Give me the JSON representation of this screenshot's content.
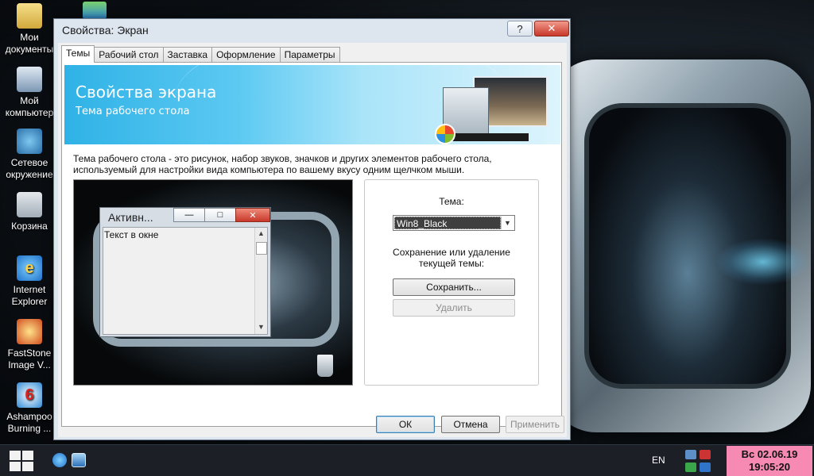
{
  "desktop": {
    "icons": [
      {
        "line1": "Мои",
        "line2": "документы"
      },
      {
        "line1": "Мой",
        "line2": "компьютер"
      },
      {
        "line1": "Сетевое",
        "line2": "окружение"
      },
      {
        "line1": "Корзина",
        "line2": ""
      },
      {
        "line1": "Internet",
        "line2": "Explorer"
      },
      {
        "line1": "FastStone",
        "line2": "Image V..."
      },
      {
        "line1": "Ashampoo",
        "line2": "Burning ..."
      }
    ]
  },
  "dialog": {
    "title": "Свойства: Экран",
    "help_label": "?",
    "close_label": "✕",
    "tabs": [
      "Темы",
      "Рабочий стол",
      "Заставка",
      "Оформление",
      "Параметры"
    ],
    "banner": {
      "title": "Свойства экрана",
      "subtitle": "Тема рабочего стола"
    },
    "description_line1": "Тема рабочего стола - это рисунок, набор звуков, значков и других элементов рабочего стола,",
    "description_line2": "используемый для настройки вида компьютера по вашему вкусу одним щелчком мыши.",
    "preview": {
      "window_title": "Активн...",
      "min_label": "—",
      "max_label": "□",
      "close_label": "✕",
      "body_text": "Текст в окне"
    },
    "theme": {
      "label": "Тема:",
      "selected": "Win8_Black",
      "save_delete_line1": "Сохранение или удаление",
      "save_delete_line2": "текущей темы:",
      "save_button": "Сохранить...",
      "delete_button": "Удалить"
    },
    "buttons": {
      "ok": "ОК",
      "cancel": "Отмена",
      "apply": "Применить"
    }
  },
  "taskbar": {
    "language": "EN",
    "clock_line1": "Вс 02.06.19",
    "clock_line2": "19:05:20"
  },
  "colors": {
    "clock_bg": "#f78ab3",
    "banner_blue": "#2fb2e6",
    "close_red": "#c8382a"
  }
}
